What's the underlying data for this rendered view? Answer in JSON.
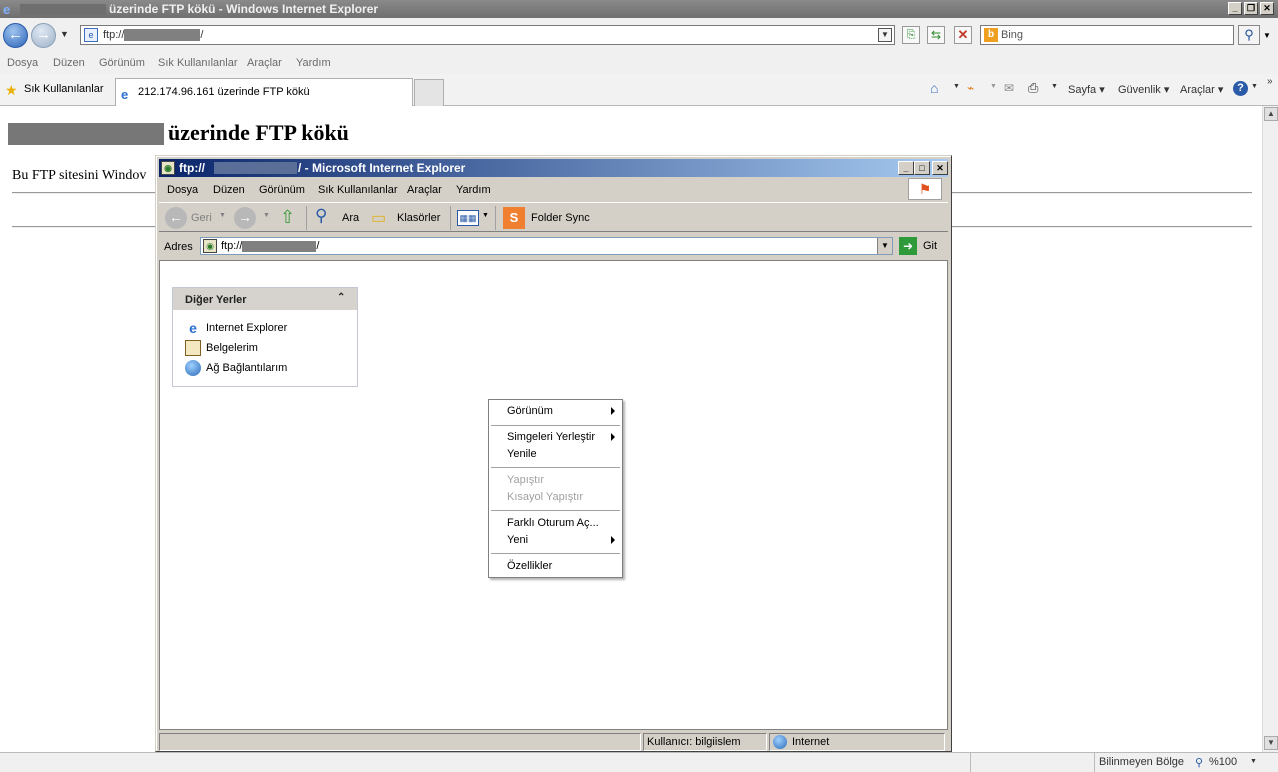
{
  "browser": {
    "title": "üzerinde FTP kökü - Windows Internet Explorer",
    "address_value": "ftp://",
    "address_suffix": "/",
    "search_placeholder": "Bing",
    "menu": [
      "Dosya",
      "Düzen",
      "Görünüm",
      "Sık Kullanılanlar",
      "Araçlar",
      "Yardım"
    ],
    "favorites_label": "Sık Kullanılanlar",
    "tab_title": "212.174.96.161 üzerinde FTP kökü",
    "command_bar": {
      "page": "Sayfa",
      "safety": "Güvenlik",
      "tools": "Araçlar"
    },
    "status_zone": "Bilinmeyen Bölge",
    "zoom": "%100"
  },
  "page": {
    "heading": "üzerinde FTP kökü",
    "paragraph": "Bu FTP sitesini Windov"
  },
  "explorer": {
    "title_prefix": "ftp://",
    "title_suffix": "/ - Microsoft Internet Explorer",
    "menu": [
      "Dosya",
      "Düzen",
      "Görünüm",
      "Sık Kullanılanlar",
      "Araçlar",
      "Yardım"
    ],
    "toolbar": {
      "back": "Geri",
      "search": "Ara",
      "folders": "Klasörler",
      "foldersync": "Folder Sync"
    },
    "address_label": "Adres",
    "address_prefix": "ftp://",
    "address_suffix": "/",
    "go_label": "Git",
    "panel": {
      "title": "Diğer Yerler",
      "items": [
        "Internet Explorer",
        "Belgelerim",
        "Ağ Bağlantılarım"
      ]
    },
    "status": {
      "user": "Kullanıcı: bilgiislem",
      "zone": "Internet"
    }
  },
  "context_menu": {
    "items": [
      {
        "label": "Görünüm",
        "submenu": true,
        "disabled": false
      },
      {
        "label": "Simgeleri Yerleştir",
        "submenu": true,
        "disabled": false
      },
      {
        "label": "Yenile",
        "submenu": false,
        "disabled": false
      },
      {
        "label": "Yapıştır",
        "submenu": false,
        "disabled": true
      },
      {
        "label": "Kısayol Yapıştır",
        "submenu": false,
        "disabled": true
      },
      {
        "label": "Farklı Oturum Aç...",
        "submenu": false,
        "disabled": false
      },
      {
        "label": "Yeni",
        "submenu": true,
        "disabled": false
      },
      {
        "label": "Özellikler",
        "submenu": false,
        "disabled": false
      }
    ]
  }
}
